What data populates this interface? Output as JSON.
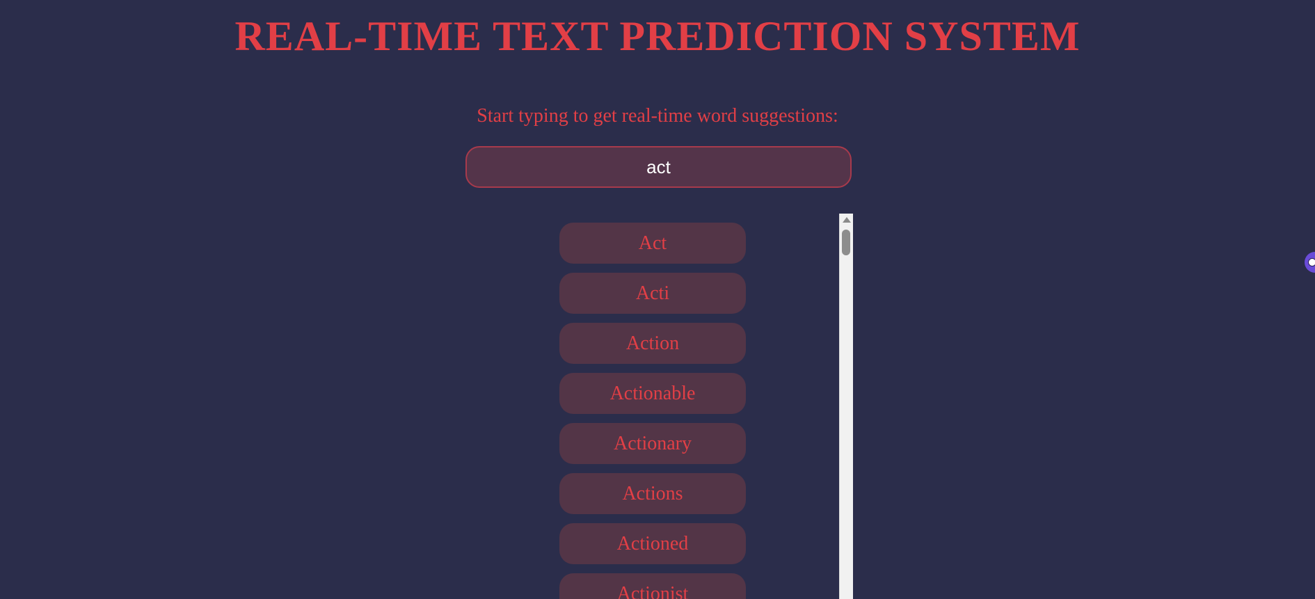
{
  "header": {
    "title": "REAL-TIME TEXT PREDICTION SYSTEM"
  },
  "main": {
    "prompt": "Start typing to get real-time word suggestions:",
    "input": {
      "value": "act",
      "placeholder": ""
    },
    "suggestions": [
      "Act",
      "Acti",
      "Action",
      "Actionable",
      "Actionary",
      "Actions",
      "Actioned",
      "Actionist"
    ]
  },
  "colors": {
    "background": "#2b2d4b",
    "accent": "#e23f46",
    "input_background": "#54344a",
    "suggestion_background": "#533547",
    "edge_widget": "#6a4cd8"
  },
  "icons": {
    "scroll_up": "triangle-up-icon",
    "edge_widget": "assistant-eye-icon"
  }
}
